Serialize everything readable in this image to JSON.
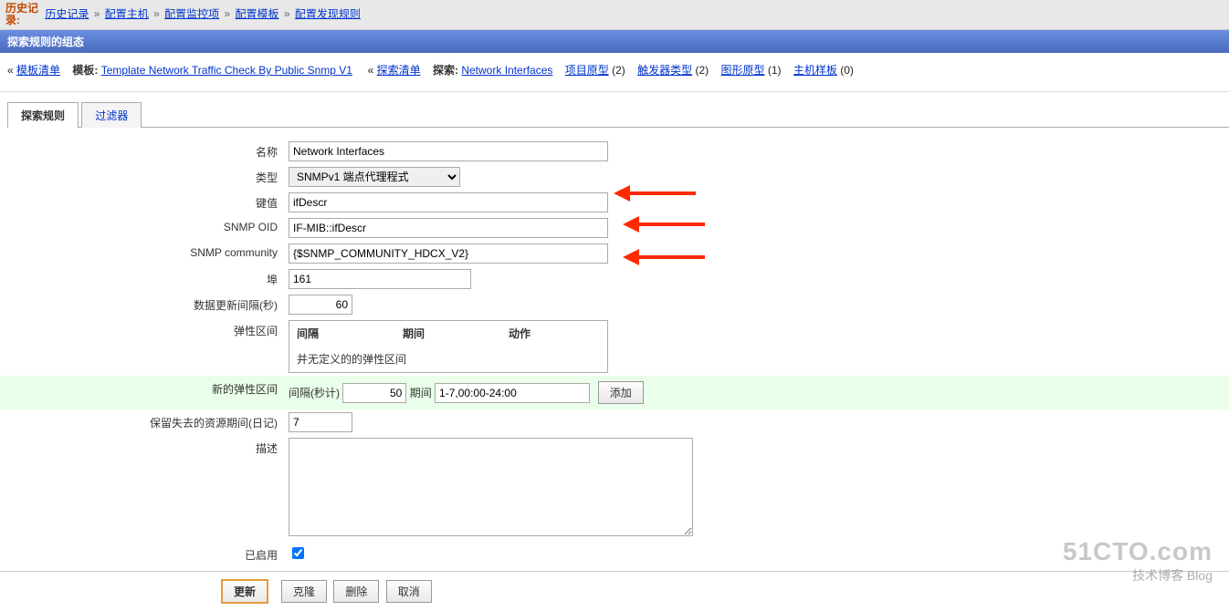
{
  "breadcrumb": {
    "prefix": "历史记录:",
    "items": [
      "历史记录",
      "配置主机",
      "配置监控项",
      "配置模板",
      "配置发现规则"
    ]
  },
  "bluebar_title": "探索规则的组态",
  "subnav": {
    "tpl_list_prefix": "«",
    "tpl_list": "模板清单",
    "tpl_label": "模板:",
    "tpl_link": "Template Network Traffic Check By Public Snmp V1",
    "disc_list_prefix": "«",
    "disc_list": "探索清单",
    "disc_label": "探索:",
    "disc_link": "Network Interfaces",
    "item_proto": "项目原型",
    "item_proto_count": "(2)",
    "trigger_proto": "触发器类型",
    "trigger_proto_count": "(2)",
    "graph_proto": "图形原型",
    "graph_proto_count": "(1)",
    "host_proto": "主机样板",
    "host_proto_count": "(0)"
  },
  "tabs": {
    "rule": "探索规则",
    "filter": "过滤器"
  },
  "form": {
    "name_label": "名称",
    "name_value": "Network Interfaces",
    "type_label": "类型",
    "type_value": "SNMPv1 端点代理程式",
    "key_label": "键值",
    "key_value": "ifDescr",
    "oid_label": "SNMP OID",
    "oid_value": "IF-MIB::ifDescr",
    "community_label": "SNMP community",
    "community_value": "{$SNMP_COMMUNITY_HDCX_V2}",
    "port_label": "埠",
    "port_value": "161",
    "interval_label": "数据更新间隔(秒)",
    "interval_value": "60",
    "flex_label": "弹性区间",
    "flex_headers": {
      "interval": "间隔",
      "period": "期间",
      "action": "动作"
    },
    "flex_empty": "并无定义的的弹性区间",
    "newflex_label": "新的弹性区间",
    "newflex_interval_label": "间隔(秒计)",
    "newflex_interval_value": "50",
    "newflex_period_label": "期间",
    "newflex_period_value": "1-7,00:00-24:00",
    "newflex_add": "添加",
    "keeplost_label": "保留失去的资源期间(日记)",
    "keeplost_value": "7",
    "desc_label": "描述",
    "desc_value": "",
    "enabled_label": "已启用"
  },
  "buttons": {
    "update": "更新",
    "clone": "克隆",
    "delete": "删除",
    "cancel": "取消"
  },
  "watermark": {
    "l1": "51CTO.com",
    "l2": "技术博客  Blog"
  }
}
